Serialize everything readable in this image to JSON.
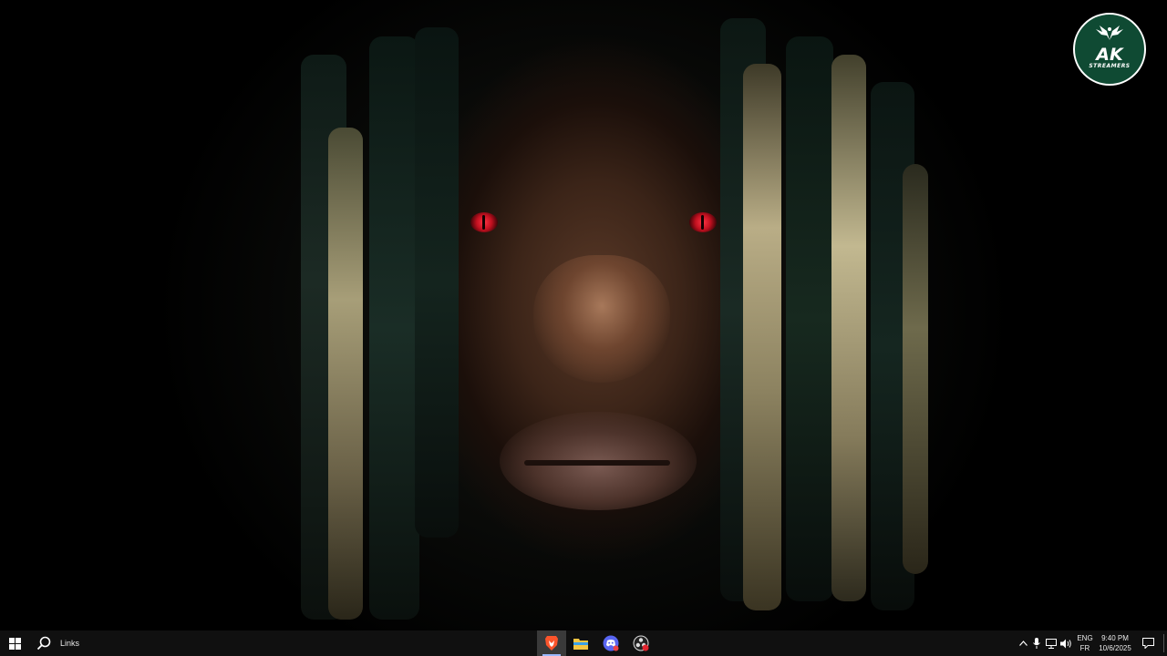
{
  "desktop": {
    "wallpaper": "close-up portrait with dreadlocks and red glowing eyes",
    "logo": {
      "main": "AK",
      "sub": "STREAMERS"
    }
  },
  "taskbar": {
    "links_label": "Links",
    "apps": [
      {
        "name": "brave-browser",
        "active": true
      },
      {
        "name": "file-explorer",
        "active": false
      },
      {
        "name": "discord",
        "active": false
      },
      {
        "name": "obs-studio",
        "active": false
      }
    ],
    "tray": {
      "lang_top": "ENG",
      "lang_bottom": "FR",
      "time": "9:40 PM",
      "date": "10/6/2025"
    }
  },
  "colors": {
    "taskbar_bg": "#101010",
    "logo_green": "#0f4a33",
    "eye_red": "#ff3344",
    "brave_orange": "#fb542b",
    "discord_blurple": "#5865f2",
    "explorer_yellow": "#f4c542"
  }
}
